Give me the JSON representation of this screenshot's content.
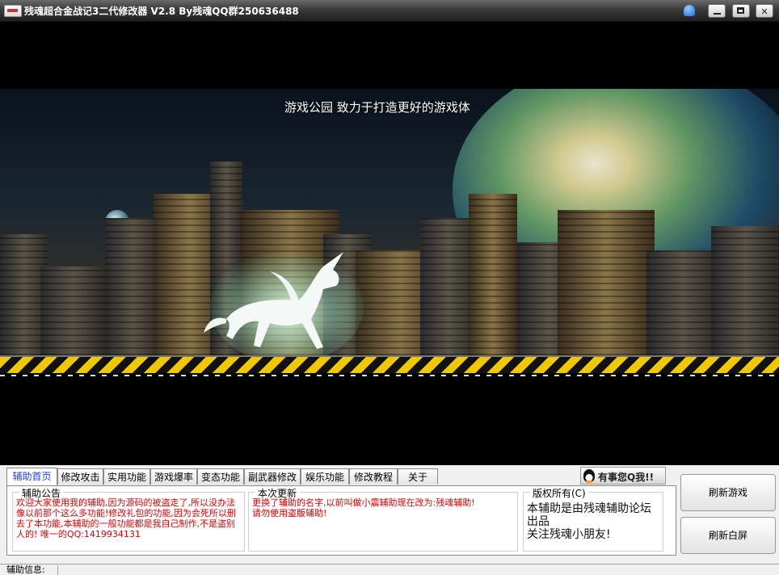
{
  "window": {
    "title": "残魂超合金战记3二代修改器  V2.8    By残魂QQ群250636488",
    "icons": [
      "app-icon",
      "skin-icon",
      "minimize-icon",
      "maximize-icon",
      "close-icon"
    ]
  },
  "banner": {
    "caption": "游戏公园 致力于打造更好的游戏体"
  },
  "tabs": [
    {
      "label": "辅助首页",
      "active": true
    },
    {
      "label": "修改攻击"
    },
    {
      "label": "实用功能"
    },
    {
      "label": "游戏爆率"
    },
    {
      "label": "变态功能"
    },
    {
      "label": "副武器修改"
    },
    {
      "label": "娱乐功能"
    },
    {
      "label": "修改教程"
    },
    {
      "label": "关于"
    }
  ],
  "notice": {
    "title": "辅助公告",
    "text": "欢迎大家使用我的辅助,因为源码的被盗走了,所以没办法像以前那个这么多功能!修改礼包的功能,因为会死所以删去了本功能,本辅助的一般功能都是我自己制作,不是盗别人的!  唯一的QQ:1419934131"
  },
  "update": {
    "title": "本次更新",
    "text": "更换了辅助的名字,以前叫做小震辅助现在改为:残魂辅助!\n请勿使用盗版辅助!"
  },
  "copyright": {
    "title": "版权所有(C)",
    "line1": "本辅助是由残魂辅助论坛出品",
    "line2": "关注残魂小朋友!"
  },
  "qq_button": {
    "label": "有事您Q我!!"
  },
  "buttons": {
    "refresh_game": "刷新游戏",
    "refresh_white": "刷新白屏"
  },
  "status": {
    "label": "辅助信息:"
  }
}
